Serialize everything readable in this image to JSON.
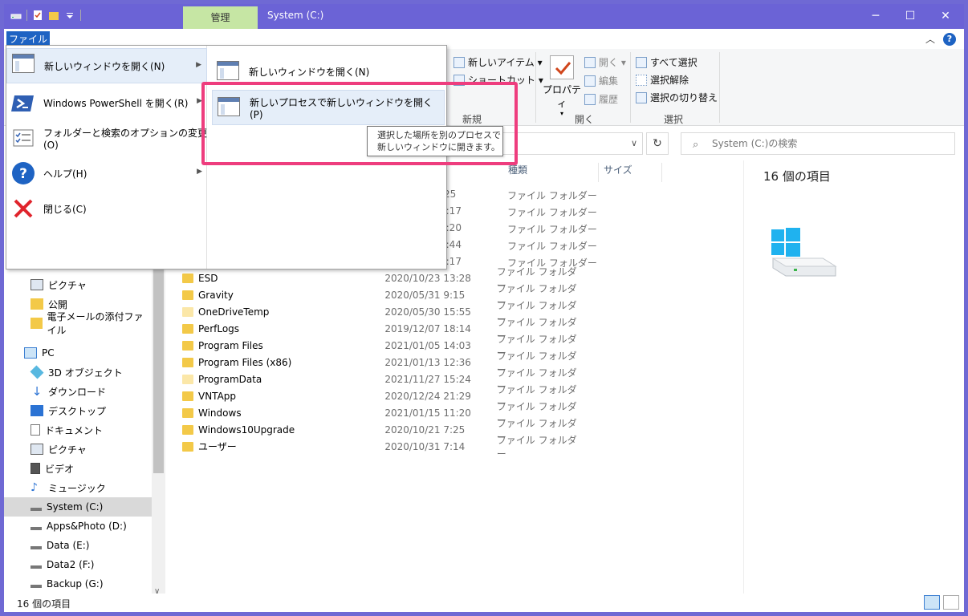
{
  "titlebar": {
    "context_tab": "管理",
    "title": "System (C:)",
    "minimize": "─",
    "maximize": "☐",
    "close": "✕"
  },
  "ribbon_tabs": {
    "file": "ファイル",
    "help": "?"
  },
  "ribbon": {
    "new_item": "新しいアイテム ▾",
    "shortcut": "ショートカット ▾",
    "group_new": "新規",
    "properties": "プロパティ",
    "open": "開く ▾",
    "edit": "編集",
    "history": "履歴",
    "group_open": "開く",
    "select_all": "すべて選択",
    "select_none": "選択解除",
    "invert_selection": "選択の切り替え",
    "group_select": "選択"
  },
  "search": {
    "placeholder": "System (C:)の検索"
  },
  "nav": {
    "items": [
      "ピクチャ",
      "公開",
      "電子メールの添付ファイル",
      "PC",
      "3D オブジェクト",
      "ダウンロード",
      "デスクトップ",
      "ドキュメント",
      "ピクチャ",
      "ビデオ",
      "ミュージック",
      "System (C:)",
      "Apps&Photo (D:)",
      "Data (E:)",
      "Data2 (F:)",
      "Backup (G:)"
    ]
  },
  "columns": {
    "type": "種類",
    "size": "サイズ"
  },
  "partial_rows": [
    {
      "date": "25",
      "type": "ファイル フォルダー"
    },
    {
      "date": "3:17",
      "type": "ファイル フォルダー"
    },
    {
      "date": "3:20",
      "type": "ファイル フォルダー"
    },
    {
      "date": "3:44",
      "type": "ファイル フォルダー"
    },
    {
      "date": "3:17",
      "type": "ファイル フォルダー"
    }
  ],
  "files": [
    {
      "name": "ESD",
      "date": "2020/10/23 13:28",
      "type": "ファイル フォルダー"
    },
    {
      "name": "Gravity",
      "date": "2020/05/31 9:15",
      "type": "ファイル フォルダー"
    },
    {
      "name": "OneDriveTemp",
      "date": "2020/05/30 15:55",
      "type": "ファイル フォルダー"
    },
    {
      "name": "PerfLogs",
      "date": "2019/12/07 18:14",
      "type": "ファイル フォルダー"
    },
    {
      "name": "Program Files",
      "date": "2021/01/05 14:03",
      "type": "ファイル フォルダー"
    },
    {
      "name": "Program Files (x86)",
      "date": "2021/01/13 12:36",
      "type": "ファイル フォルダー"
    },
    {
      "name": "ProgramData",
      "date": "2021/11/27 15:24",
      "type": "ファイル フォルダー"
    },
    {
      "name": "VNTApp",
      "date": "2020/12/24 21:29",
      "type": "ファイル フォルダー"
    },
    {
      "name": "Windows",
      "date": "2021/01/15 11:20",
      "type": "ファイル フォルダー"
    },
    {
      "name": "Windows10Upgrade",
      "date": "2020/10/21 7:25",
      "type": "ファイル フォルダー"
    },
    {
      "name": "ユーザー",
      "date": "2020/10/31 7:14",
      "type": "ファイル フォルダー"
    }
  ],
  "details": {
    "count": "16 個の項目"
  },
  "status": {
    "count": "16 個の項目"
  },
  "file_menu": {
    "items": [
      "新しいウィンドウを開く(N)",
      "Windows PowerShell を開く(R)",
      "フォルダーと検索のオプションの変更(O)",
      "ヘルプ(H)",
      "閉じる(C)"
    ],
    "submenu": [
      "新しいウィンドウを開く(N)",
      "新しいプロセスで新しいウィンドウを開く(P)"
    ],
    "tooltip_line1": "選択した場所を別のプロセスで",
    "tooltip_line2": "新しいウィンドウに開きます。"
  },
  "colors": {
    "titlebar": "#6b63d6",
    "file_tab": "#1e63c3",
    "context_tab": "#c6e6a4",
    "highlight_box": "#ee3d7e",
    "folder": "#f3c948"
  }
}
